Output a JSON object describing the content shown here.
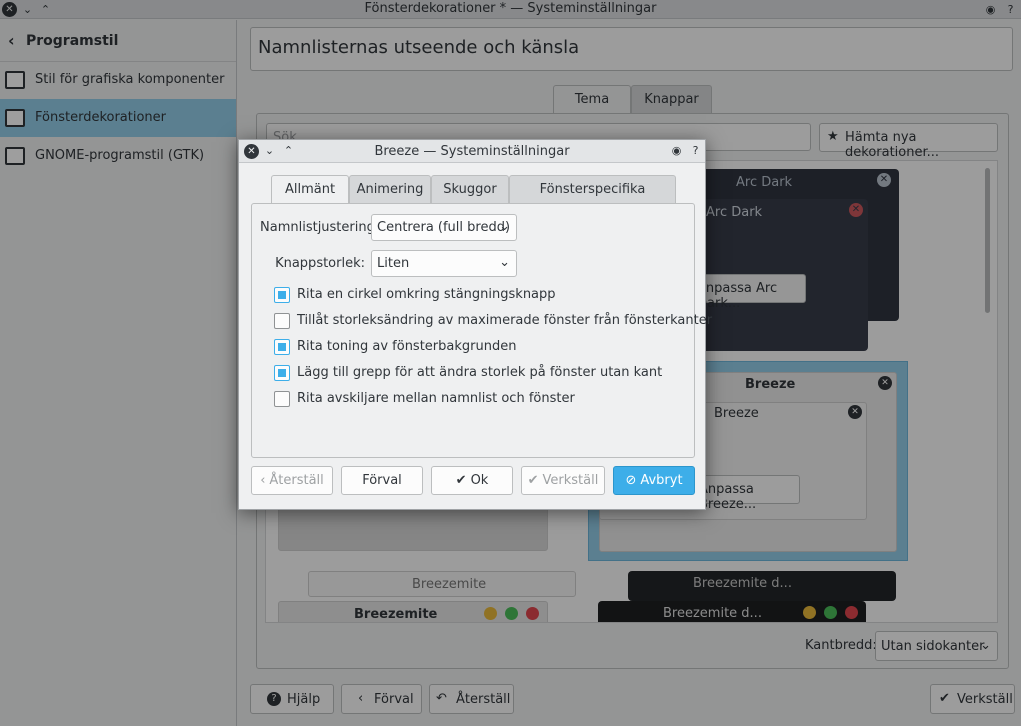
{
  "window": {
    "title": "Fönsterdekorationer * — Systeminställningar",
    "close_glyph": "✕",
    "min_glyph": "⌄",
    "max_glyph": "⌃",
    "help_glyph": "?",
    "pin_glyph": "◉"
  },
  "sidebar": {
    "back_label": "Programstil",
    "back_glyph": "‹",
    "items": [
      {
        "label": "Stil för grafiska komponenter",
        "icon": "widget-style-icon"
      },
      {
        "label": "Fönsterdekorationer",
        "icon": "window-decorations-icon",
        "selected": true
      },
      {
        "label": "GNOME-programstil (GTK)",
        "icon": "gtk-icon"
      }
    ]
  },
  "main": {
    "header": "Namnlisternas utseende och känsla",
    "tabs": [
      {
        "label": "Tema",
        "active": true
      },
      {
        "label": "Knappar"
      }
    ],
    "search_placeholder": "Sök...",
    "get_new_label": "Hämta nya dekorationer...",
    "get_new_glyph": "★",
    "themes": {
      "arc_dark": "Arc Dark",
      "arc_dark_configure": "Anpassa Arc Dark...",
      "breeze": "Breeze",
      "breeze_configure": "Anpassa Breeze...",
      "breezemite": "Breezemite",
      "breezemite_dark": "Breezemite d..."
    },
    "border_label": "Kantbredd:",
    "border_value": "Utan sidokanter",
    "combo_glyph": "⌄"
  },
  "bottombar": {
    "help": "Hjälp",
    "help_glyph": "?",
    "defaults": "Förval",
    "defaults_glyph": "‹",
    "reset": "Återställ",
    "reset_glyph": "↶",
    "apply": "Verkställ",
    "apply_glyph": "✔"
  },
  "dialog": {
    "title": "Breeze — Systeminställningar",
    "tabs": [
      {
        "label": "Allmänt",
        "active": true
      },
      {
        "label": "Animering"
      },
      {
        "label": "Skuggor"
      },
      {
        "label": "Fönsterspecifika alternativ"
      }
    ],
    "fields": {
      "title_alignment_label": "Namnlistjustering:",
      "title_alignment_value": "Centrera (full bredd)",
      "button_size_label": "Knappstorlek:",
      "button_size_value": "Liten"
    },
    "checkboxes": [
      {
        "label": "Rita en cirkel omkring stängningsknapp",
        "checked": true
      },
      {
        "label": "Tillåt storleksändring av maximerade fönster från fönsterkanter",
        "checked": false
      },
      {
        "label": "Rita toning av fönsterbakgrunden",
        "checked": true
      },
      {
        "label": "Lägg till grepp för att ändra storlek på fönster utan kant",
        "checked": true
      },
      {
        "label": "Rita avskiljare mellan namnlist och fönster",
        "checked": false
      }
    ],
    "buttons": {
      "reset": "Återställ",
      "reset_glyph": "‹",
      "defaults": "Förval",
      "ok": "Ok",
      "ok_glyph": "✔",
      "apply": "Verkställ",
      "apply_glyph": "✔",
      "cancel": "Avbryt",
      "cancel_glyph": "⊘"
    }
  },
  "colors": {
    "accent": "#3daee9",
    "selection": "#93cee9",
    "dark_deco": "#2f343f"
  }
}
